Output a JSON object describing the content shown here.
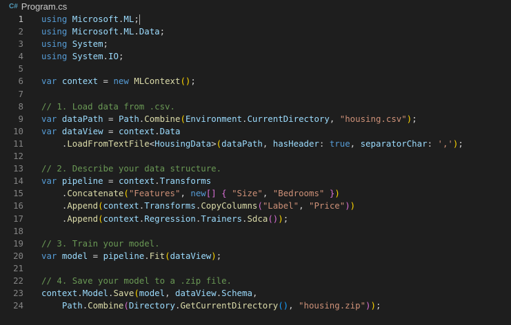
{
  "tab": {
    "icon": "csharp-icon",
    "icon_glyph": "C#",
    "filename": "Program.cs"
  },
  "colors": {
    "background": "#1e1e1e",
    "keyword": "#569cd6",
    "identifier": "#9cdcfe",
    "function": "#dcdcaa",
    "string": "#ce9178",
    "comment": "#6a9955",
    "plain": "#d4d4d4",
    "bracket_level1": "#ffd700",
    "bracket_level2": "#da70d6",
    "bracket_level3": "#179fff",
    "line_number": "#858585"
  },
  "editor": {
    "active_line": 1,
    "lines": [
      {
        "num": "1",
        "tokens": [
          [
            "kw",
            "using"
          ],
          [
            "pl",
            " "
          ],
          [
            "id",
            "Microsoft"
          ],
          [
            "pl",
            "."
          ],
          [
            "id",
            "ML"
          ],
          [
            "pl",
            ";"
          ],
          [
            "cursor",
            ""
          ]
        ]
      },
      {
        "num": "2",
        "tokens": [
          [
            "kw",
            "using"
          ],
          [
            "pl",
            " "
          ],
          [
            "id",
            "Microsoft"
          ],
          [
            "pl",
            "."
          ],
          [
            "id",
            "ML"
          ],
          [
            "pl",
            "."
          ],
          [
            "id",
            "Data"
          ],
          [
            "pl",
            ";"
          ]
        ]
      },
      {
        "num": "3",
        "tokens": [
          [
            "kw",
            "using"
          ],
          [
            "pl",
            " "
          ],
          [
            "id",
            "System"
          ],
          [
            "pl",
            ";"
          ]
        ]
      },
      {
        "num": "4",
        "tokens": [
          [
            "kw",
            "using"
          ],
          [
            "pl",
            " "
          ],
          [
            "id",
            "System"
          ],
          [
            "pl",
            "."
          ],
          [
            "id",
            "IO"
          ],
          [
            "pl",
            ";"
          ]
        ]
      },
      {
        "num": "5",
        "tokens": []
      },
      {
        "num": "6",
        "tokens": [
          [
            "kw",
            "var"
          ],
          [
            "pl",
            " "
          ],
          [
            "id",
            "context"
          ],
          [
            "pl",
            " = "
          ],
          [
            "kw",
            "new"
          ],
          [
            "pl",
            " "
          ],
          [
            "fn",
            "MLContext"
          ],
          [
            "b1",
            "()"
          ],
          [
            "pl",
            ";"
          ]
        ]
      },
      {
        "num": "7",
        "tokens": []
      },
      {
        "num": "8",
        "tokens": [
          [
            "cm",
            "// 1. Load data from .csv."
          ]
        ]
      },
      {
        "num": "9",
        "tokens": [
          [
            "kw",
            "var"
          ],
          [
            "pl",
            " "
          ],
          [
            "id",
            "dataPath"
          ],
          [
            "pl",
            " = "
          ],
          [
            "id",
            "Path"
          ],
          [
            "pl",
            "."
          ],
          [
            "fn",
            "Combine"
          ],
          [
            "b1",
            "("
          ],
          [
            "id",
            "Environment"
          ],
          [
            "pl",
            "."
          ],
          [
            "id",
            "CurrentDirectory"
          ],
          [
            "pl",
            ", "
          ],
          [
            "str",
            "\"housing.csv\""
          ],
          [
            "b1",
            ")"
          ],
          [
            "pl",
            ";"
          ]
        ]
      },
      {
        "num": "10",
        "tokens": [
          [
            "kw",
            "var"
          ],
          [
            "pl",
            " "
          ],
          [
            "id",
            "dataView"
          ],
          [
            "pl",
            " = "
          ],
          [
            "id",
            "context"
          ],
          [
            "pl",
            "."
          ],
          [
            "id",
            "Data"
          ]
        ]
      },
      {
        "num": "11",
        "tokens": [
          [
            "pl",
            "    ."
          ],
          [
            "fn",
            "LoadFromTextFile"
          ],
          [
            "pl",
            "<"
          ],
          [
            "id",
            "HousingData"
          ],
          [
            "pl",
            ">"
          ],
          [
            "b1",
            "("
          ],
          [
            "id",
            "dataPath"
          ],
          [
            "pl",
            ", "
          ],
          [
            "id",
            "hasHeader"
          ],
          [
            "pl",
            ": "
          ],
          [
            "kw",
            "true"
          ],
          [
            "pl",
            ", "
          ],
          [
            "id",
            "separatorChar"
          ],
          [
            "pl",
            ": "
          ],
          [
            "str",
            "','"
          ],
          [
            "b1",
            ")"
          ],
          [
            "pl",
            ";"
          ]
        ]
      },
      {
        "num": "12",
        "tokens": []
      },
      {
        "num": "13",
        "tokens": [
          [
            "cm",
            "// 2. Describe your data structure."
          ]
        ]
      },
      {
        "num": "14",
        "tokens": [
          [
            "kw",
            "var"
          ],
          [
            "pl",
            " "
          ],
          [
            "id",
            "pipeline"
          ],
          [
            "pl",
            " = "
          ],
          [
            "id",
            "context"
          ],
          [
            "pl",
            "."
          ],
          [
            "id",
            "Transforms"
          ]
        ]
      },
      {
        "num": "15",
        "tokens": [
          [
            "pl",
            "    ."
          ],
          [
            "fn",
            "Concatenate"
          ],
          [
            "b1",
            "("
          ],
          [
            "str",
            "\"Features\""
          ],
          [
            "pl",
            ", "
          ],
          [
            "kw",
            "new"
          ],
          [
            "b2",
            "[]"
          ],
          [
            "pl",
            " "
          ],
          [
            "b2",
            "{"
          ],
          [
            "pl",
            " "
          ],
          [
            "str",
            "\"Size\""
          ],
          [
            "pl",
            ", "
          ],
          [
            "str",
            "\"Bedrooms\""
          ],
          [
            "pl",
            " "
          ],
          [
            "b2",
            "}"
          ],
          [
            "b1",
            ")"
          ]
        ]
      },
      {
        "num": "16",
        "tokens": [
          [
            "pl",
            "    ."
          ],
          [
            "fn",
            "Append"
          ],
          [
            "b1",
            "("
          ],
          [
            "id",
            "context"
          ],
          [
            "pl",
            "."
          ],
          [
            "id",
            "Transforms"
          ],
          [
            "pl",
            "."
          ],
          [
            "fn",
            "CopyColumns"
          ],
          [
            "b2",
            "("
          ],
          [
            "str",
            "\"Label\""
          ],
          [
            "pl",
            ", "
          ],
          [
            "str",
            "\"Price\""
          ],
          [
            "b2",
            ")"
          ],
          [
            "b1",
            ")"
          ]
        ]
      },
      {
        "num": "17",
        "tokens": [
          [
            "pl",
            "    ."
          ],
          [
            "fn",
            "Append"
          ],
          [
            "b1",
            "("
          ],
          [
            "id",
            "context"
          ],
          [
            "pl",
            "."
          ],
          [
            "id",
            "Regression"
          ],
          [
            "pl",
            "."
          ],
          [
            "id",
            "Trainers"
          ],
          [
            "pl",
            "."
          ],
          [
            "fn",
            "Sdca"
          ],
          [
            "b2",
            "()"
          ],
          [
            "b1",
            ")"
          ],
          [
            "pl",
            ";"
          ]
        ]
      },
      {
        "num": "18",
        "tokens": []
      },
      {
        "num": "19",
        "tokens": [
          [
            "cm",
            "// 3. Train your model."
          ]
        ]
      },
      {
        "num": "20",
        "tokens": [
          [
            "kw",
            "var"
          ],
          [
            "pl",
            " "
          ],
          [
            "id",
            "model"
          ],
          [
            "pl",
            " = "
          ],
          [
            "id",
            "pipeline"
          ],
          [
            "pl",
            "."
          ],
          [
            "fn",
            "Fit"
          ],
          [
            "b1",
            "("
          ],
          [
            "id",
            "dataView"
          ],
          [
            "b1",
            ")"
          ],
          [
            "pl",
            ";"
          ]
        ]
      },
      {
        "num": "21",
        "tokens": []
      },
      {
        "num": "22",
        "tokens": [
          [
            "cm",
            "// 4. Save your model to a .zip file."
          ]
        ]
      },
      {
        "num": "23",
        "tokens": [
          [
            "id",
            "context"
          ],
          [
            "pl",
            "."
          ],
          [
            "id",
            "Model"
          ],
          [
            "pl",
            "."
          ],
          [
            "fn",
            "Save"
          ],
          [
            "b1",
            "("
          ],
          [
            "id",
            "model"
          ],
          [
            "pl",
            ", "
          ],
          [
            "id",
            "dataView"
          ],
          [
            "pl",
            "."
          ],
          [
            "id",
            "Schema"
          ],
          [
            "pl",
            ","
          ]
        ]
      },
      {
        "num": "24",
        "tokens": [
          [
            "pl",
            "    "
          ],
          [
            "id",
            "Path"
          ],
          [
            "pl",
            "."
          ],
          [
            "fn",
            "Combine"
          ],
          [
            "b2",
            "("
          ],
          [
            "id",
            "Directory"
          ],
          [
            "pl",
            "."
          ],
          [
            "fn",
            "GetCurrentDirectory"
          ],
          [
            "b3",
            "()"
          ],
          [
            "pl",
            ", "
          ],
          [
            "str",
            "\"housing.zip\""
          ],
          [
            "b2",
            ")"
          ],
          [
            "b1",
            ")"
          ],
          [
            "pl",
            ";"
          ]
        ]
      }
    ]
  }
}
